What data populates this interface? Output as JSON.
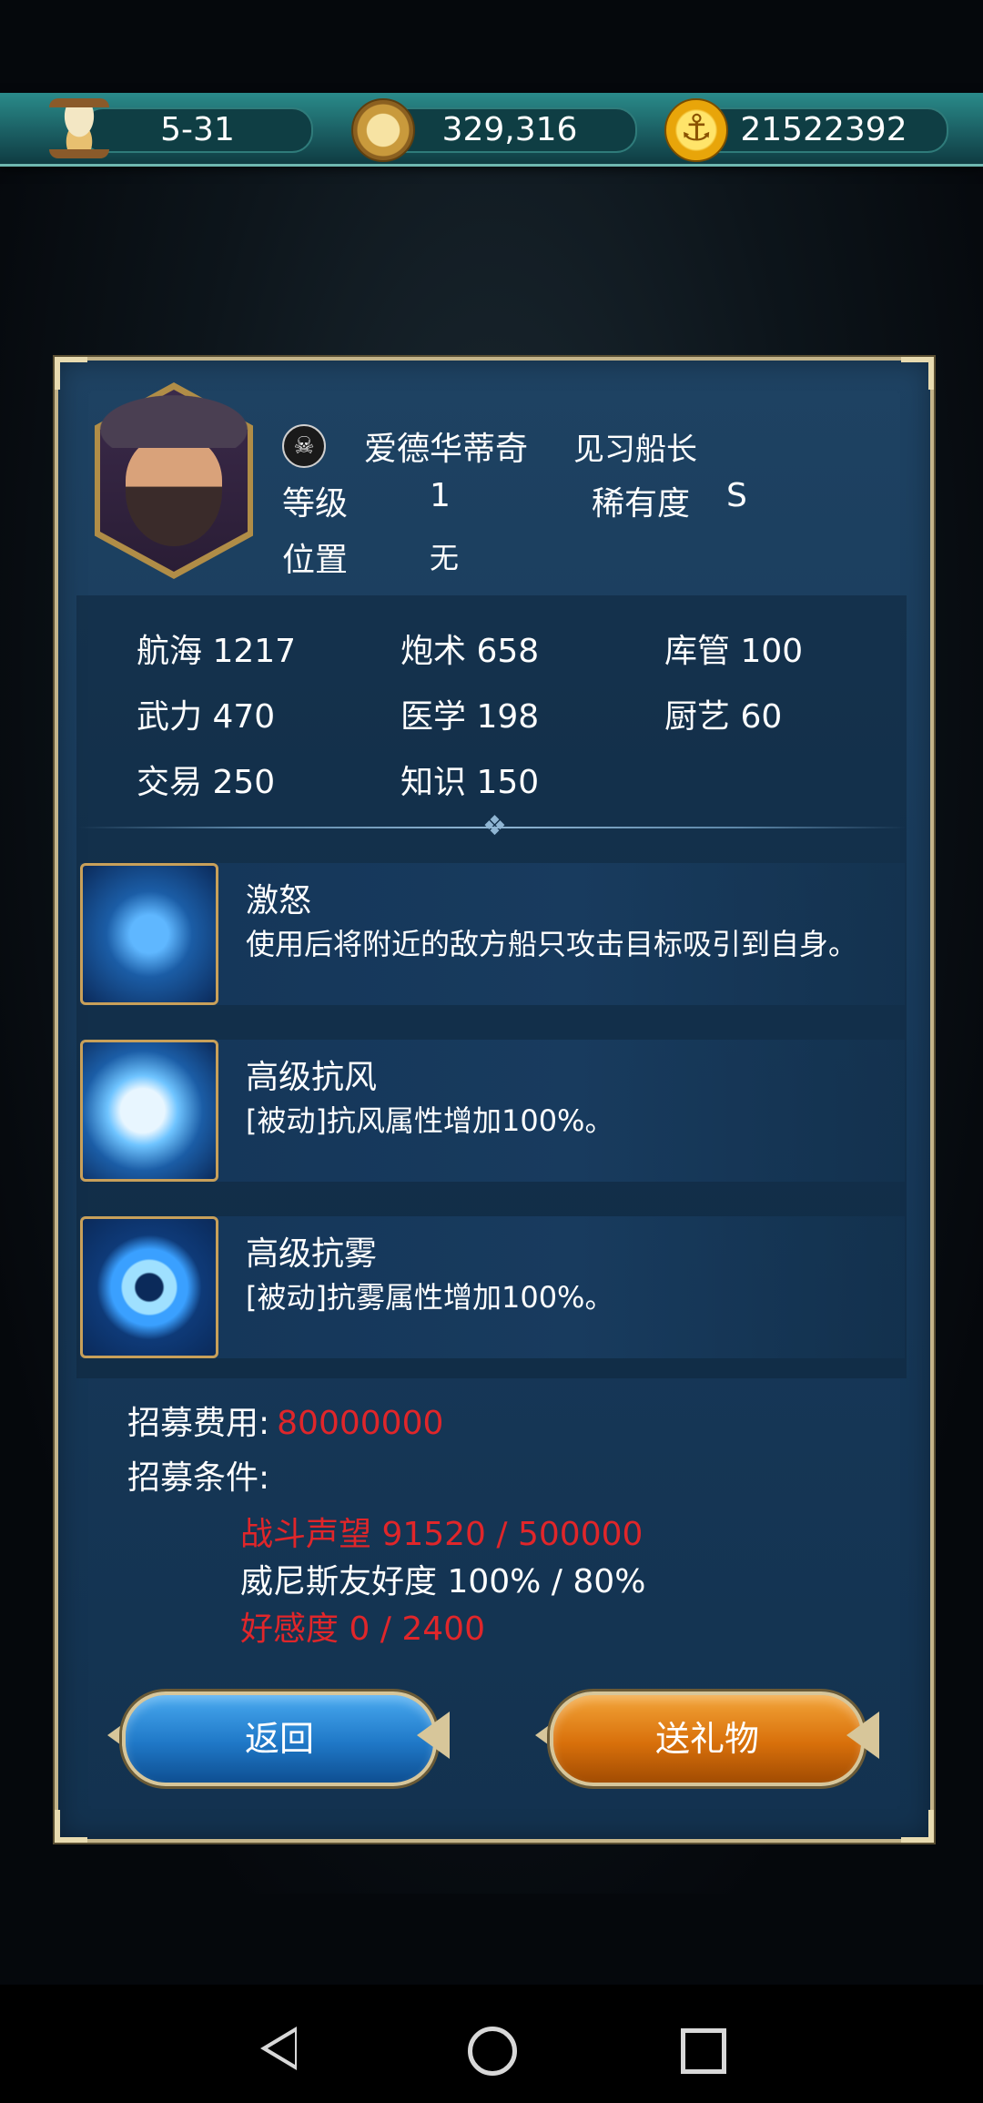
{
  "topbar": {
    "time_value": "5-31",
    "compass_value": "329,316",
    "gold_value": "21522392"
  },
  "captain": {
    "name": "爱德华蒂奇",
    "title": "见习船长",
    "level_label": "等级",
    "level_value": "1",
    "rarity_label": "稀有度",
    "rarity_value": "S",
    "position_label": "位置",
    "position_value": "无"
  },
  "stats": [
    {
      "label": "航海",
      "value": "1217"
    },
    {
      "label": "炮术",
      "value": "658"
    },
    {
      "label": "库管",
      "value": "100"
    },
    {
      "label": "武力",
      "value": "470"
    },
    {
      "label": "医学",
      "value": "198"
    },
    {
      "label": "厨艺",
      "value": "60"
    },
    {
      "label": "交易",
      "value": "250"
    },
    {
      "label": "知识",
      "value": "150"
    }
  ],
  "skills": [
    {
      "name": "激怒",
      "desc": "使用后将附近的敌方船只攻击目标吸引到自身。",
      "icon": "rage-ship-icon"
    },
    {
      "name": "高级抗风",
      "desc": "[被动]抗风属性增加100%。",
      "icon": "wind-resist-icon"
    },
    {
      "name": "高级抗雾",
      "desc": "[被动]抗雾属性增加100%。",
      "icon": "fog-resist-icon"
    }
  ],
  "recruit": {
    "cost_label": "招募费用:",
    "cost_value": "80000000",
    "cond_label": "招募条件:",
    "conditions": [
      {
        "text": "战斗声望 91520 / 500000",
        "met": false
      },
      {
        "text": "威尼斯友好度 100% / 80%",
        "met": true
      },
      {
        "text": "好感度 0 / 2400",
        "met": false
      }
    ]
  },
  "buttons": {
    "back_label": "返回",
    "gift_label": "送礼物"
  },
  "colors": {
    "unmet": "#e0262a",
    "met": "#ffffff",
    "panel": "#1e4262",
    "border": "#c4b48a"
  }
}
